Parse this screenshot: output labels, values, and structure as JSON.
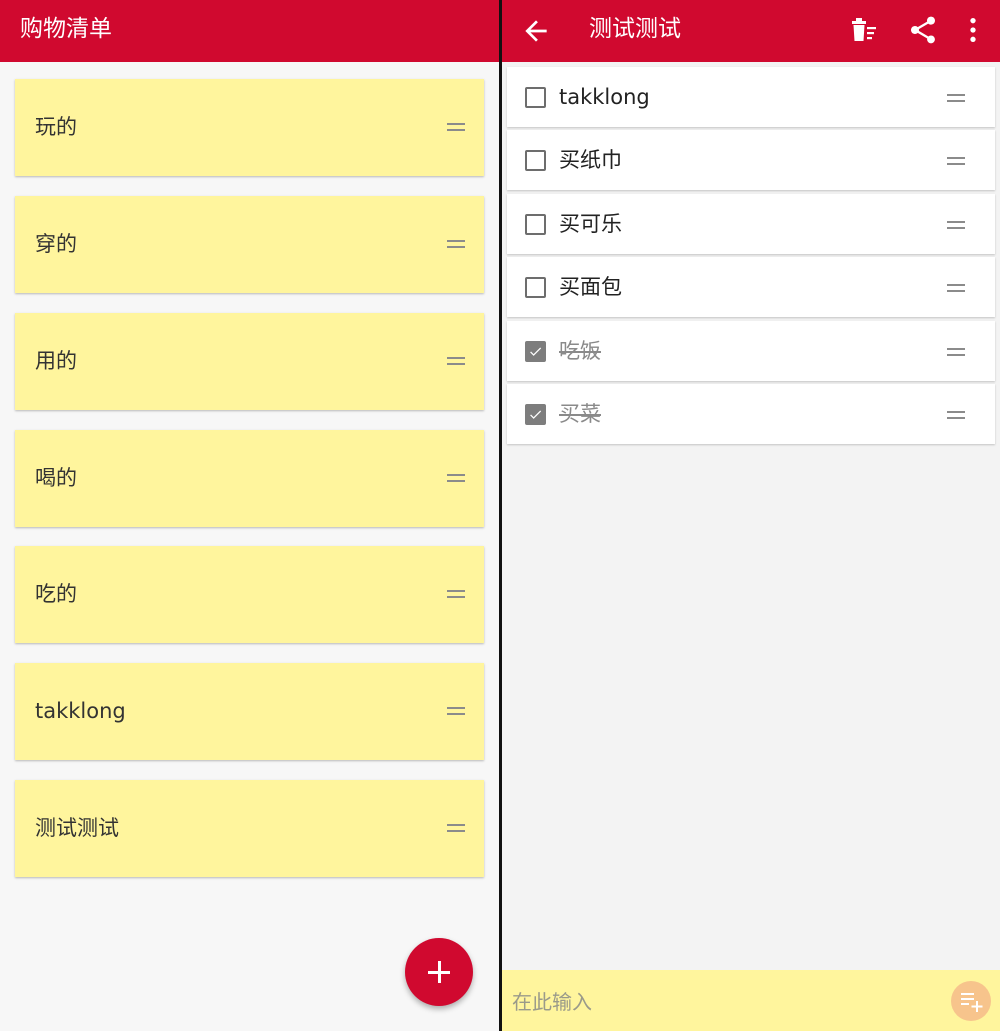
{
  "left": {
    "title": "购物清单",
    "lists": [
      {
        "label": "玩的"
      },
      {
        "label": "穿的"
      },
      {
        "label": "用的"
      },
      {
        "label": "喝的"
      },
      {
        "label": "吃的"
      },
      {
        "label": "takklong"
      },
      {
        "label": "测试测试"
      }
    ],
    "fab_icon": "plus-icon"
  },
  "right": {
    "title": "测试测试",
    "toolbar_icons": [
      "back-arrow-icon",
      "clear-done-icon",
      "share-icon",
      "more-vert-icon"
    ],
    "items": [
      {
        "label": "takklong",
        "checked": false
      },
      {
        "label": "买纸巾",
        "checked": false
      },
      {
        "label": "买可乐",
        "checked": false
      },
      {
        "label": "买面包",
        "checked": false
      },
      {
        "label": "吃饭",
        "checked": true
      },
      {
        "label": "买菜",
        "checked": true
      }
    ],
    "input": {
      "placeholder": "在此输入",
      "value": ""
    },
    "add_icon": "playlist-add-icon"
  },
  "colors": {
    "app_bar": "#d0092f",
    "list_card": "#fff59d",
    "fab": "#d0092f",
    "add_button": "#f7c48c",
    "checked_box": "#7d7d7d"
  }
}
